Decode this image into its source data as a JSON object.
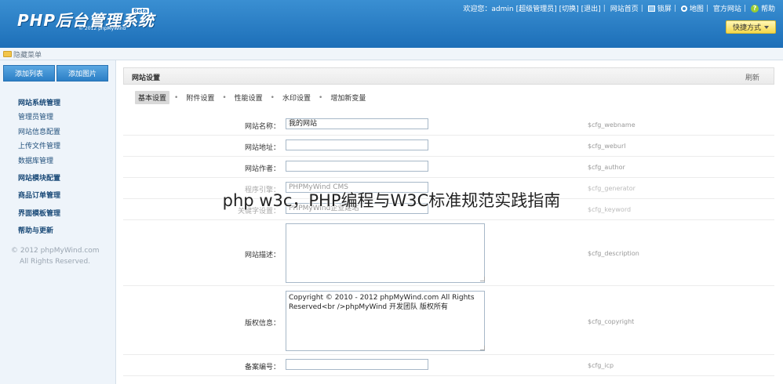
{
  "header": {
    "logo_text": "PHP后台管理系统",
    "logo_badge": "Beta",
    "logo_copyright": "© 2012 phpMyWind",
    "welcome": "欢迎您：admin",
    "role": "[超级管理员]",
    "switch": "[切换]",
    "logout": "[退出]",
    "home": "网站首页",
    "lock": "锁屏",
    "sitemap": "地图",
    "official": "官方网站",
    "help": "帮助",
    "quick": "快捷方式"
  },
  "subbar": {
    "label": "隐藏菜单"
  },
  "sidebar": {
    "btn_add_list": "添加列表",
    "btn_add_image": "添加图片",
    "items": [
      {
        "label": "网站系统管理",
        "group": true
      },
      {
        "label": "管理员管理",
        "group": false
      },
      {
        "label": "网站信息配置",
        "group": false
      },
      {
        "label": "上传文件管理",
        "group": false
      },
      {
        "label": "数据库管理",
        "group": false
      },
      {
        "label": "网站模块配置",
        "group": true
      },
      {
        "label": "商品订单管理",
        "group": true
      },
      {
        "label": "界面模板管理",
        "group": true
      },
      {
        "label": "帮助与更新",
        "group": true
      }
    ],
    "copyright1": "© 2012 phpMyWind.com",
    "copyright2": "All Rights Reserved."
  },
  "panel": {
    "title": "网站设置",
    "refresh": "刷新",
    "tabs": [
      "基本设置",
      "附件设置",
      "性能设置",
      "水印设置",
      "增加新变量"
    ],
    "active_tab": "基本设置"
  },
  "fields": [
    {
      "label": "网站名称：",
      "value": "我的网站",
      "var": "$cfg_webname"
    },
    {
      "label": "网站地址：",
      "value": "",
      "var": "$cfg_weburl"
    },
    {
      "label": "网站作者：",
      "value": "",
      "var": "$cfg_author"
    },
    {
      "label": "程序引擎：",
      "value": "PHPMyWind CMS",
      "var": "$cfg_generator"
    },
    {
      "label": "关键字设置：",
      "value": "PHPMyWind企业建站",
      "var": "$cfg_keyword"
    },
    {
      "label": "网站描述：",
      "value": "",
      "var": "$cfg_description"
    },
    {
      "label": "版权信息：",
      "value_line1": "Copyright © 2010 - 2012 phpMyWind.com All Rights",
      "value_line2": "Reserved<br />phpMyWind 开发团队 版权所有",
      "var": "$cfg_copyright"
    },
    {
      "label": "备案编号：",
      "value": "",
      "var": "$cfg_icp"
    }
  ],
  "overlay": "php w3c，PHP编程与W3C标准规范实践指南"
}
